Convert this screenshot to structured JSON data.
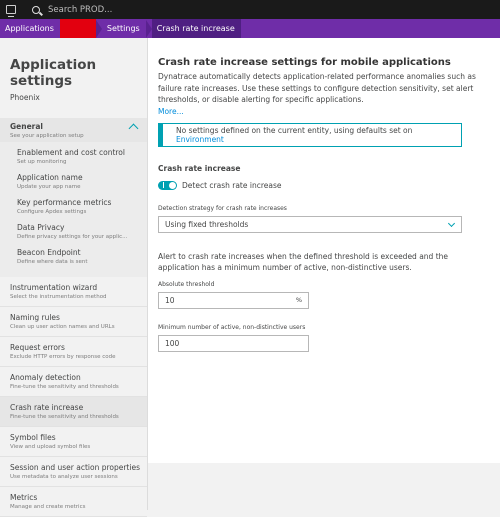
{
  "topbar": {
    "app_icon": "screen-icon",
    "search_icon": "search-icon",
    "search_placeholder": "Search PROD..."
  },
  "breadcrumb": {
    "items": [
      "Applications",
      "",
      "Settings",
      "Crash rate increase"
    ]
  },
  "sidebar": {
    "title": "Application settings",
    "app_name": "Phoenix",
    "general": {
      "label": "General",
      "desc": "See your application setup"
    },
    "sub_items": [
      {
        "label": "Enablement and cost control",
        "desc": "Set up monitoring"
      },
      {
        "label": "Application name",
        "desc": "Update your app name"
      },
      {
        "label": "Key performance metrics",
        "desc": "Configure Apdex settings"
      },
      {
        "label": "Data Privacy",
        "desc": "Define privacy settings for your applic..."
      },
      {
        "label": "Beacon Endpoint",
        "desc": "Define where data is sent"
      }
    ],
    "items": [
      {
        "label": "Instrumentation wizard",
        "desc": "Select the instrumentation method"
      },
      {
        "label": "Naming rules",
        "desc": "Clean up user action names and URLs"
      },
      {
        "label": "Request errors",
        "desc": "Exclude HTTP errors by response code"
      },
      {
        "label": "Anomaly detection",
        "desc": "Fine-tune the sensitivity and thresholds"
      },
      {
        "label": "Crash rate increase",
        "desc": "Fine-tune the sensitivity and thresholds"
      },
      {
        "label": "Symbol files",
        "desc": "View and upload symbol files"
      },
      {
        "label": "Session and user action properties",
        "desc": "Use metadata to analyze user sessions"
      },
      {
        "label": "Metrics",
        "desc": "Manage and create metrics"
      }
    ]
  },
  "main": {
    "title": "Crash rate increase settings for mobile applications",
    "intro": "Dynatrace automatically detects application-related performance anomalies such as failure rate increases. Use these settings to configure detection sensitivity, set alert thresholds, or disable alerting for specific applications.",
    "more": "More...",
    "notice_text": "No settings defined on the current entity, using defaults set on ",
    "notice_link": "Environment",
    "section_label": "Crash rate increase",
    "toggle_label": "Detect crash rate increase",
    "strategy_label": "Detection strategy for crash rate increases",
    "strategy_value": "Using fixed thresholds",
    "threshold_paragraph": "Alert to crash rate increases when the defined threshold is exceeded and the application has a minimum number of active, non-distinctive users.",
    "abs_threshold_label": "Absolute threshold",
    "abs_threshold_value": "10",
    "abs_threshold_unit": "%",
    "min_users_label": "Minimum number of active, non-distinctive users",
    "min_users_value": "100"
  },
  "colors": {
    "breadcrumb_bg": "#6f2da8",
    "accent": "#00a1b2",
    "link": "#008cdb",
    "env_red": "#e2000f"
  }
}
